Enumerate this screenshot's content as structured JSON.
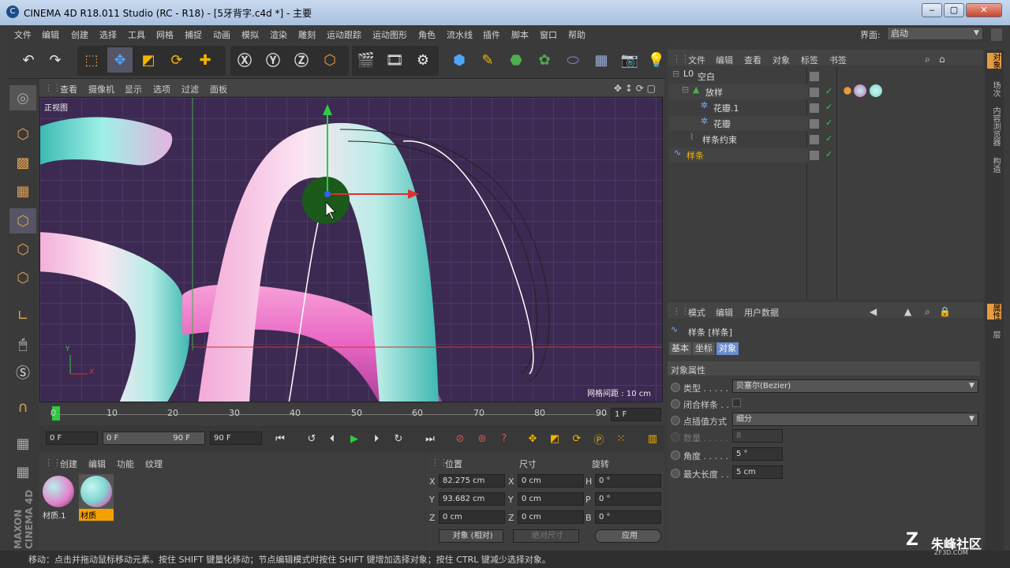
{
  "window": {
    "title": "CINEMA 4D R18.011 Studio (RC - R18) - [5牙背字.c4d *] - 主要",
    "minimize": "‒",
    "maximize": "▢",
    "close": "✕"
  },
  "menu": [
    "文件",
    "编辑",
    "创建",
    "选择",
    "工具",
    "网格",
    "捕捉",
    "动画",
    "模拟",
    "渲染",
    "雕刻",
    "运动跟踪",
    "运动图形",
    "角色",
    "流水线",
    "插件",
    "脚本",
    "窗口",
    "帮助"
  ],
  "layout": {
    "label": "界面:",
    "value": "启动"
  },
  "viewport": {
    "menu": [
      "查看",
      "摄像机",
      "显示",
      "选项",
      "过滤",
      "面板"
    ],
    "label": "正视图",
    "grid": "网格间距 : 10 cm",
    "axis_y": "Y",
    "axis_x": "X"
  },
  "timeline": {
    "ticks": [
      "0",
      "10",
      "20",
      "30",
      "40",
      "50",
      "60",
      "70",
      "80",
      "90"
    ],
    "current": "1 F"
  },
  "playback": {
    "start": "0 F",
    "range_start": "0 F",
    "range_end": "90 F",
    "end": "90 F"
  },
  "materials": {
    "menu": [
      "创建",
      "编辑",
      "功能",
      "纹理"
    ],
    "items": [
      "材质.1",
      "材质"
    ]
  },
  "coords": {
    "headers": [
      "位置",
      "尺寸",
      "旋转"
    ],
    "rows": [
      {
        "pl": "X",
        "pv": "82.275 cm",
        "sl": "X",
        "sv": "0 cm",
        "rl": "H",
        "rv": "0 °"
      },
      {
        "pl": "Y",
        "pv": "93.682 cm",
        "sl": "Y",
        "sv": "0 cm",
        "rl": "P",
        "rv": "0 °"
      },
      {
        "pl": "Z",
        "pv": "0 cm",
        "sl": "Z",
        "sv": "0 cm",
        "rl": "B",
        "rv": "0 °"
      }
    ],
    "mode": "对象 (相对)",
    "size_mode": "绝对尺寸",
    "apply": "应用"
  },
  "objects": {
    "menu": [
      "文件",
      "编辑",
      "查看",
      "对象",
      "标签",
      "书签"
    ],
    "rows": [
      "空白",
      "放样",
      "花瓣.1",
      "花瓣",
      "样条约束",
      "样条"
    ]
  },
  "attributes": {
    "menu": [
      "模式",
      "编辑",
      "用户数据"
    ],
    "title": "样条 [样条]",
    "tabs": [
      "基本",
      "坐标",
      "对象"
    ],
    "section": "对象属性",
    "fields": [
      {
        "label": "类型 . . . . .",
        "value": "贝塞尔(Bezier)"
      },
      {
        "label": "闭合样条 . .",
        "value": ""
      },
      {
        "label": "点插值方式",
        "value": "细分"
      },
      {
        "label": "数量 . . . . .",
        "value": "8"
      },
      {
        "label": "角度 . . . . .",
        "value": "5 °"
      },
      {
        "label": "最大长度 . .",
        "value": "5 cm"
      }
    ]
  },
  "right_tabs": [
    "对象",
    "场次",
    "内容浏览器",
    "构造",
    "属性",
    "层"
  ],
  "left_brand": "MAXON CINEMA 4D",
  "status": "移动：点击并拖动鼠标移动元素。按住 SHIFT 键量化移动；节点编辑模式时按住 SHIFT 键增加选择对象；按住 CTRL 键减少选择对象。",
  "watermark": {
    "text": "朱峰社区",
    "sub": "ZF3D.COM"
  }
}
